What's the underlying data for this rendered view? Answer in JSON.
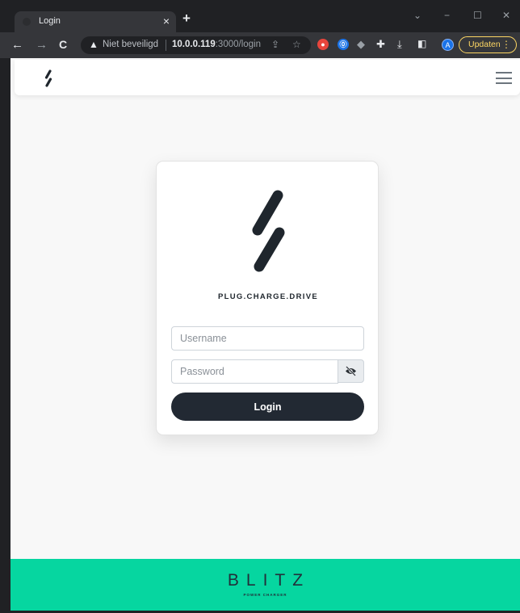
{
  "browser": {
    "tab": {
      "title": "Login",
      "close": "×"
    },
    "new_tab": "+",
    "window_controls": {
      "collapse": "⌄",
      "minimize": "−",
      "maximize": "☐",
      "close": "✕"
    },
    "nav": {
      "back": "←",
      "forward": "→",
      "reload": "C"
    },
    "omnibox": {
      "security_label": "Niet beveiligd",
      "url_host": "10.0.0.119",
      "url_rest": ":3000/login"
    },
    "profile_initial": "A",
    "update_button": "Updaten",
    "colors": {
      "frame": "#202124",
      "toolbar": "#35363a",
      "update": "#fdd663"
    }
  },
  "app": {
    "tagline": "PLUG.CHARGE.DRIVE",
    "form": {
      "username_placeholder": "Username",
      "password_placeholder": "Password",
      "login_label": "Login"
    },
    "footer": {
      "brand": "BLITZ",
      "brand_sub": "POWER CHARGER"
    },
    "colors": {
      "primary": "#222933",
      "accent": "#06d6a0",
      "background": "#f8f8f8"
    }
  }
}
